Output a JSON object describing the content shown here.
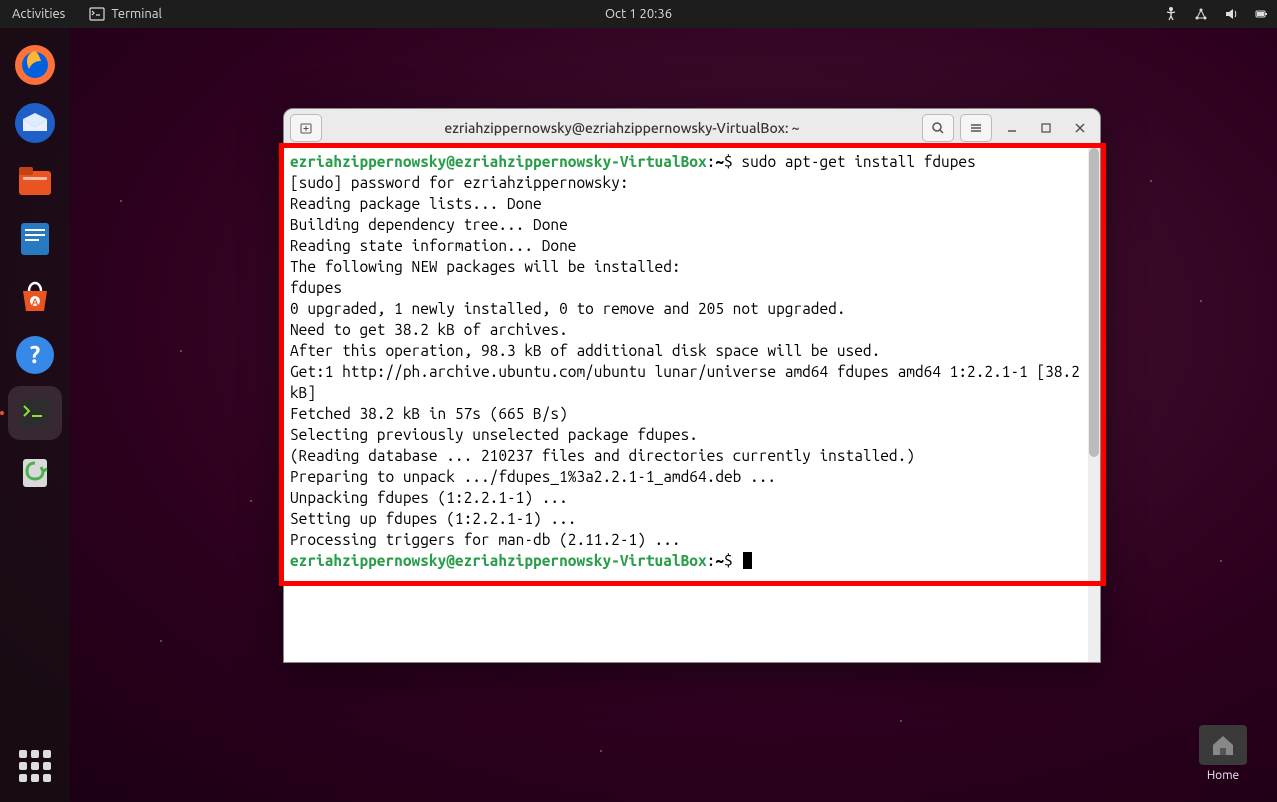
{
  "topbar": {
    "activities": "Activities",
    "app_name": "Terminal",
    "datetime": "Oct 1  20:36"
  },
  "dock": {
    "items": [
      {
        "name": "firefox"
      },
      {
        "name": "thunderbird"
      },
      {
        "name": "files"
      },
      {
        "name": "libreoffice-writer"
      },
      {
        "name": "software"
      },
      {
        "name": "help"
      },
      {
        "name": "terminal"
      },
      {
        "name": "trash"
      }
    ]
  },
  "desktop": {
    "home_label": "Home"
  },
  "window": {
    "title": "ezriahzippernowsky@ezriahzippernowsky-VirtualBox: ~"
  },
  "terminal": {
    "prompt_user": "ezriahzippernowsky@ezriahzippernowsky-VirtualBox",
    "prompt_sep": ":",
    "prompt_path": "~",
    "prompt_char": "$",
    "command1": " sudo apt-get install fdupes",
    "lines": [
      "[sudo] password for ezriahzippernowsky:",
      "Reading package lists... Done",
      "Building dependency tree... Done",
      "Reading state information... Done",
      "The following NEW packages will be installed:",
      "  fdupes",
      "0 upgraded, 1 newly installed, 0 to remove and 205 not upgraded.",
      "Need to get 38.2 kB of archives.",
      "After this operation, 98.3 kB of additional disk space will be used.",
      "Get:1 http://ph.archive.ubuntu.com/ubuntu lunar/universe amd64 fdupes amd64 1:2.2.1-1 [38.2 kB]",
      "Fetched 38.2 kB in 57s (665 B/s)",
      "Selecting previously unselected package fdupes.",
      "(Reading database ... 210237 files and directories currently installed.)",
      "Preparing to unpack .../fdupes_1%3a2.2.1-1_amd64.deb ...",
      "Unpacking fdupes (1:2.2.1-1) ...",
      "Setting up fdupes (1:2.2.1-1) ...",
      "Processing triggers for man-db (2.11.2-1) ..."
    ]
  }
}
